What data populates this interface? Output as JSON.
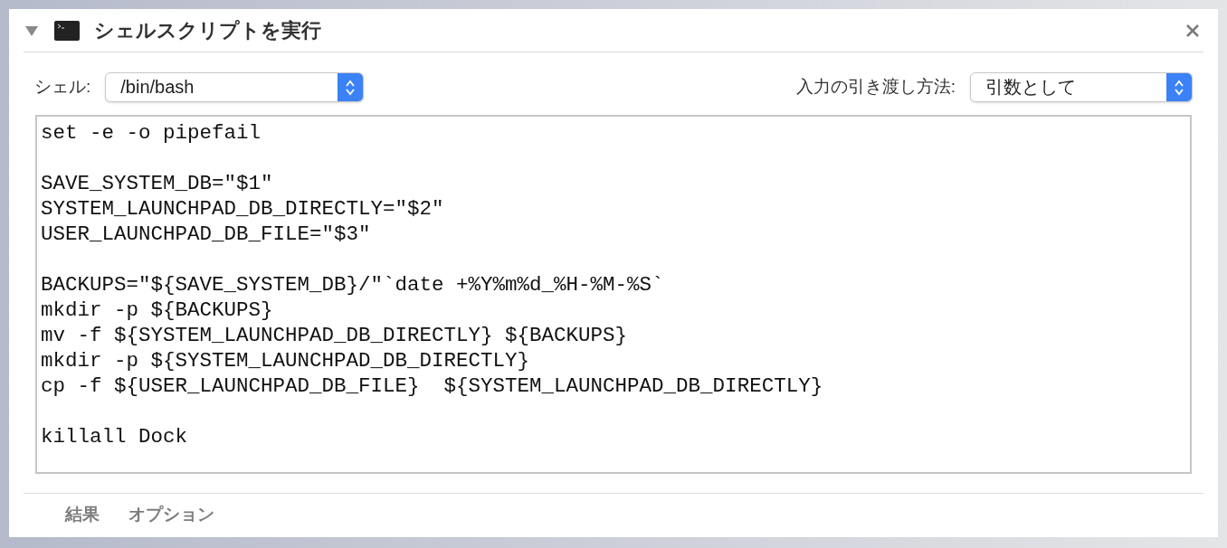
{
  "action": {
    "title": "シェルスクリプトを実行",
    "expanded": true
  },
  "shell": {
    "label": "シェル:",
    "value": "/bin/bash"
  },
  "input_method": {
    "label": "入力の引き渡し方法:",
    "value": "引数として"
  },
  "script": "set -e -o pipefail\n\nSAVE_SYSTEM_DB=\"$1\"\nSYSTEM_LAUNCHPAD_DB_DIRECTLY=\"$2\"\nUSER_LAUNCHPAD_DB_FILE=\"$3\"\n\nBACKUPS=\"${SAVE_SYSTEM_DB}/\"`date +%Y%m%d_%H-%M-%S`\nmkdir -p ${BACKUPS}\nmv -f ${SYSTEM_LAUNCHPAD_DB_DIRECTLY} ${BACKUPS}\nmkdir -p ${SYSTEM_LAUNCHPAD_DB_DIRECTLY}\ncp -f ${USER_LAUNCHPAD_DB_FILE}  ${SYSTEM_LAUNCHPAD_DB_DIRECTLY}\n\nkillall Dock",
  "footer_tabs": [
    {
      "label": "結果",
      "selected": false
    },
    {
      "label": "オプション",
      "selected": false
    }
  ]
}
